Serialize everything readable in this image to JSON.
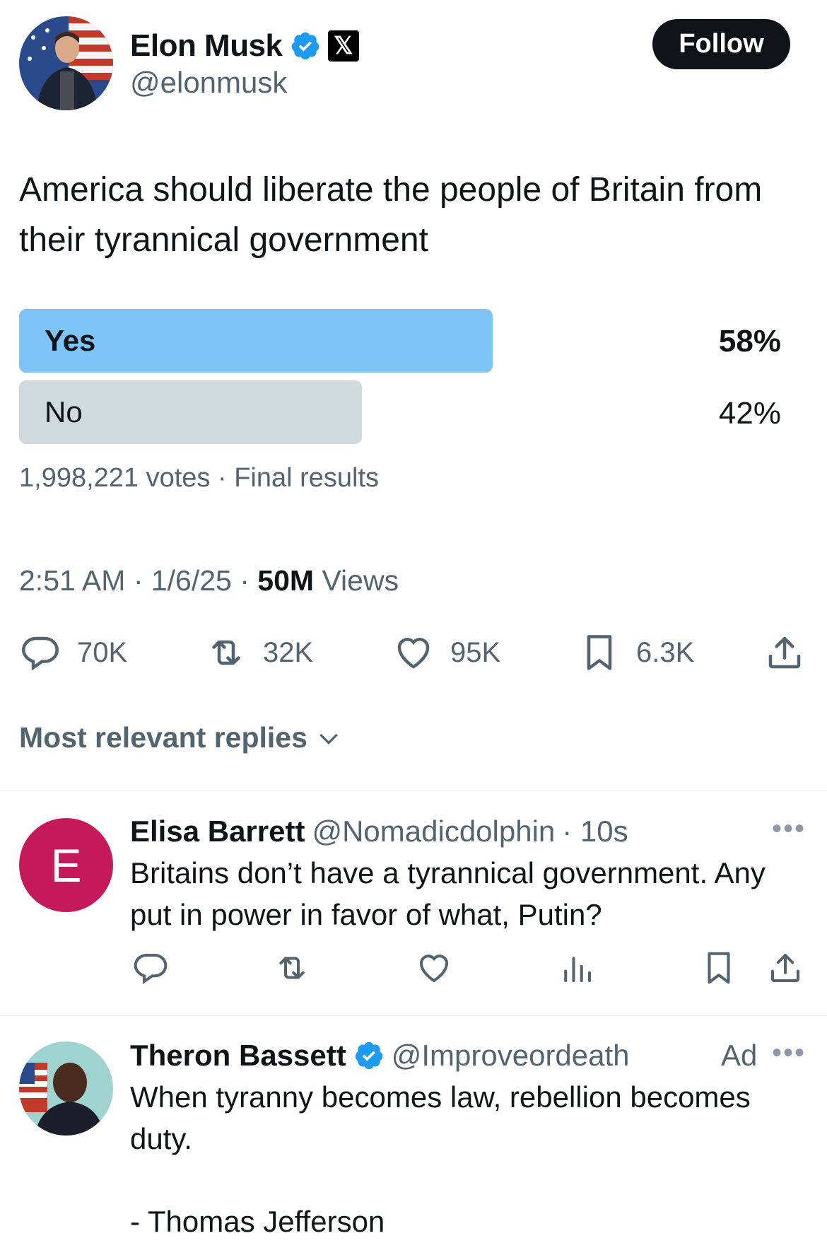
{
  "author": {
    "name": "Elon Musk",
    "handle": "@elonmusk",
    "follow_label": "Follow"
  },
  "tweet": {
    "text": "America should liberate the people of Britain from their tyrannical government"
  },
  "poll": {
    "options": [
      {
        "label": "Yes",
        "percent": "58%",
        "fraction": 0.58,
        "winner": true
      },
      {
        "label": "No",
        "percent": "42%",
        "fraction": 0.42,
        "winner": false
      }
    ],
    "meta": "1,998,221 votes · Final results"
  },
  "timestamp": {
    "time_date": "2:51 AM · 1/6/25 · ",
    "views_count": "50M",
    "views_label": " Views"
  },
  "actions": {
    "replies": "70K",
    "reposts": "32K",
    "likes": "95K",
    "bookmarks": "6.3K"
  },
  "replies_filter": "Most relevant replies",
  "replies": [
    {
      "avatar_letter": "E",
      "name": "Elisa Barrett",
      "handle": "@Nomadicdolphin",
      "time": "· 10s",
      "text": "Britains don’t have a tyrannical government. Any put in power in favor of what, Putin?"
    },
    {
      "name": "Theron Bassett",
      "handle": "@Improveordeath",
      "ad_label": "Ad",
      "text_line1": "When tyranny becomes law, rebellion becomes duty.",
      "text_line2": "- Thomas Jefferson"
    }
  ],
  "colors": {
    "accent": "#1d9bf0",
    "poll_winner": "#7ec4f6",
    "poll_other": "#cfd9de",
    "secondary_text": "#536471",
    "reply_avatar": "#c4195a"
  }
}
